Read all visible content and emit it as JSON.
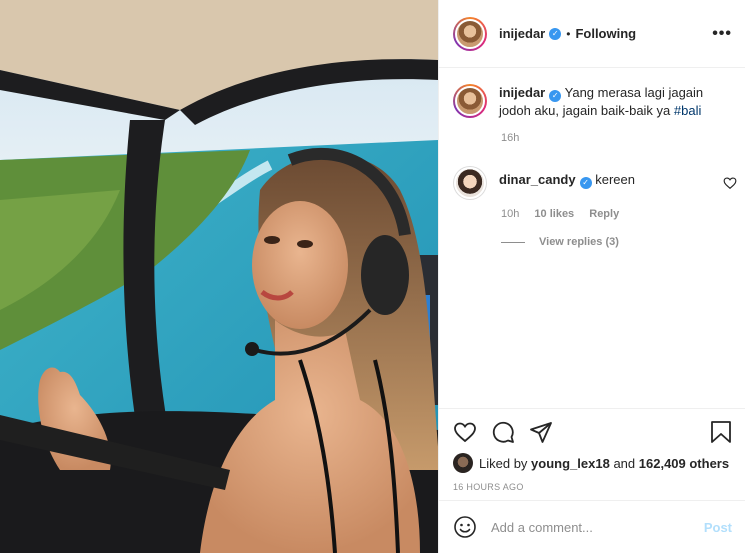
{
  "post": {
    "author": "inijedar",
    "follow_status": "Following",
    "separator": "•",
    "more_label": "•••"
  },
  "caption": {
    "username": "inijedar",
    "text": "Yang merasa lagi jagain jodoh aku, jagain baik-baik ya",
    "hashtag": "#bali",
    "age": "16h"
  },
  "comments": [
    {
      "username": "dinar_candy",
      "text": "kereen",
      "age": "10h",
      "likes": "10 likes",
      "reply_label": "Reply",
      "view_replies": "View replies (3)"
    }
  ],
  "likes": {
    "prefix": "Liked by",
    "user": "young_lex18",
    "middle": "and",
    "count": "162,409 others"
  },
  "timestamp": "16 HOURS AGO",
  "add_comment": {
    "placeholder": "Add a comment...",
    "post_label": "Post"
  },
  "colors": {
    "link": "#00376b",
    "verified": "#3897f0",
    "muted": "#8e8e8e",
    "post_disabled": "#b2dffc"
  },
  "icons": [
    "heart-icon",
    "comment-icon",
    "share-icon",
    "bookmark-icon",
    "emoji-icon",
    "more-icon",
    "verified-icon"
  ]
}
